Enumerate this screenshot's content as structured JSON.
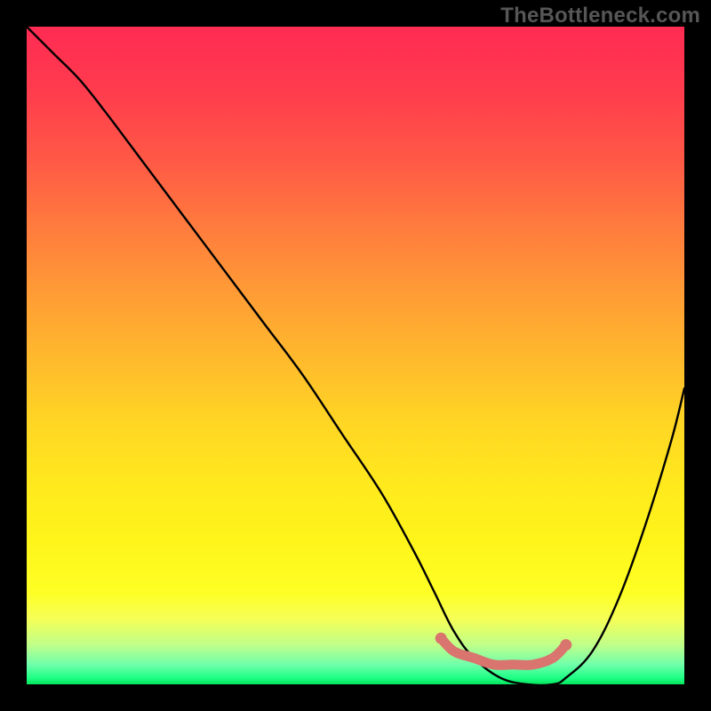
{
  "watermark": "TheBottleneck.com",
  "chart_data": {
    "type": "line",
    "title": "",
    "xlabel": "",
    "ylabel": "",
    "xlim": [
      0,
      100
    ],
    "ylim": [
      0,
      100
    ],
    "series": [
      {
        "name": "bottleneck-curve",
        "x": [
          0,
          4,
          8,
          12,
          18,
          24,
          30,
          36,
          42,
          48,
          54,
          59,
          62,
          65,
          68,
          72,
          76,
          80,
          82,
          86,
          90,
          94,
          98,
          100
        ],
        "y": [
          100,
          96,
          92,
          87,
          79,
          71,
          63,
          55,
          47,
          38,
          29,
          20,
          14,
          8,
          4,
          1,
          0,
          0,
          1,
          5,
          13,
          24,
          37,
          45
        ]
      }
    ],
    "highlight": {
      "name": "optimal-range",
      "color": "#d9746e",
      "x": [
        63,
        65,
        68,
        71,
        74,
        77,
        80,
        82
      ],
      "y": [
        7,
        5,
        4,
        3,
        3,
        3,
        4,
        6
      ]
    },
    "background_gradient": {
      "stops": [
        {
          "pos": 0.0,
          "color": "#ff2b53"
        },
        {
          "pos": 0.5,
          "color": "#ffb82d"
        },
        {
          "pos": 0.86,
          "color": "#feff24"
        },
        {
          "pos": 1.0,
          "color": "#06e55e"
        }
      ]
    }
  }
}
